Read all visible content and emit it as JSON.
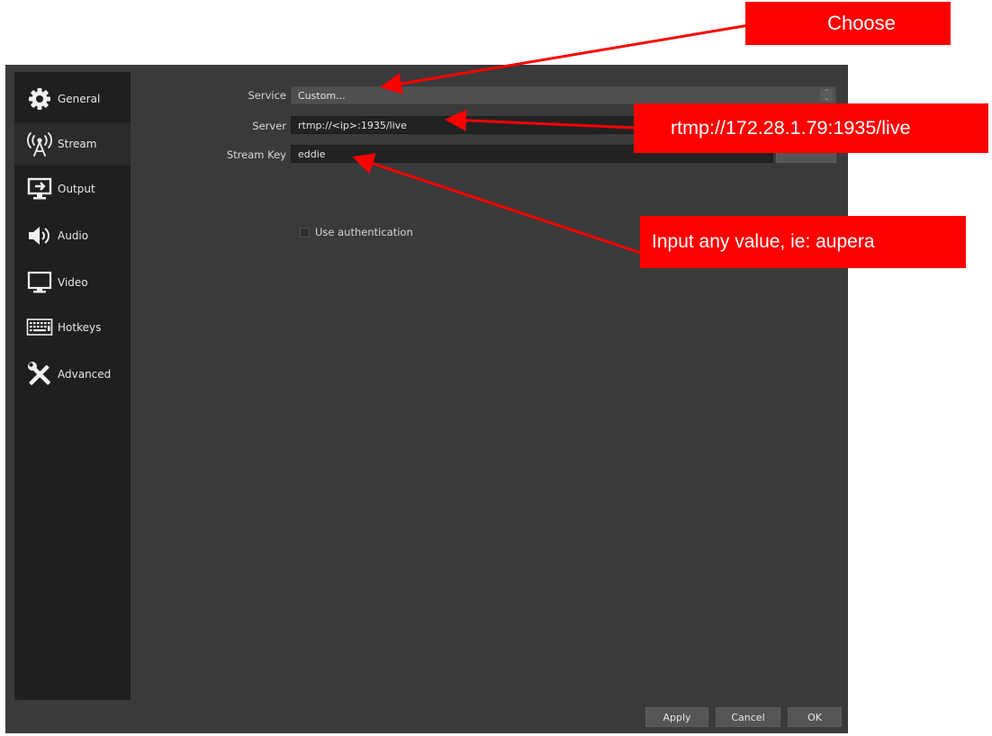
{
  "sidebar": {
    "items": [
      {
        "label": "General",
        "icon": "gear-icon"
      },
      {
        "label": "Stream",
        "icon": "broadcast-antenna-icon"
      },
      {
        "label": "Output",
        "icon": "output-monitor-icon"
      },
      {
        "label": "Audio",
        "icon": "speaker-icon"
      },
      {
        "label": "Video",
        "icon": "monitor-icon"
      },
      {
        "label": "Hotkeys",
        "icon": "keyboard-icon"
      },
      {
        "label": "Advanced",
        "icon": "tools-icon"
      }
    ],
    "active": "Stream"
  },
  "form": {
    "service_label": "Service",
    "service_value": "Custom...",
    "server_label": "Server",
    "server_value": "rtmp://<ip>:1935/live",
    "stream_key_label": "Stream Key",
    "stream_key_value": "eddie",
    "use_auth_label": "Use authentication",
    "use_auth_checked": false
  },
  "buttons": {
    "apply": "Apply",
    "cancel": "Cancel",
    "ok": "OK"
  },
  "annotations": {
    "choose": "Choose",
    "server_url": "rtmp://172.28.1.79:1935/live",
    "input_hint": "Input any value, ie: aupera"
  },
  "colors": {
    "annotation_red": "#fd0000",
    "window_bg": "#3a3a3a",
    "sidebar_bg": "#1f1f1f"
  }
}
